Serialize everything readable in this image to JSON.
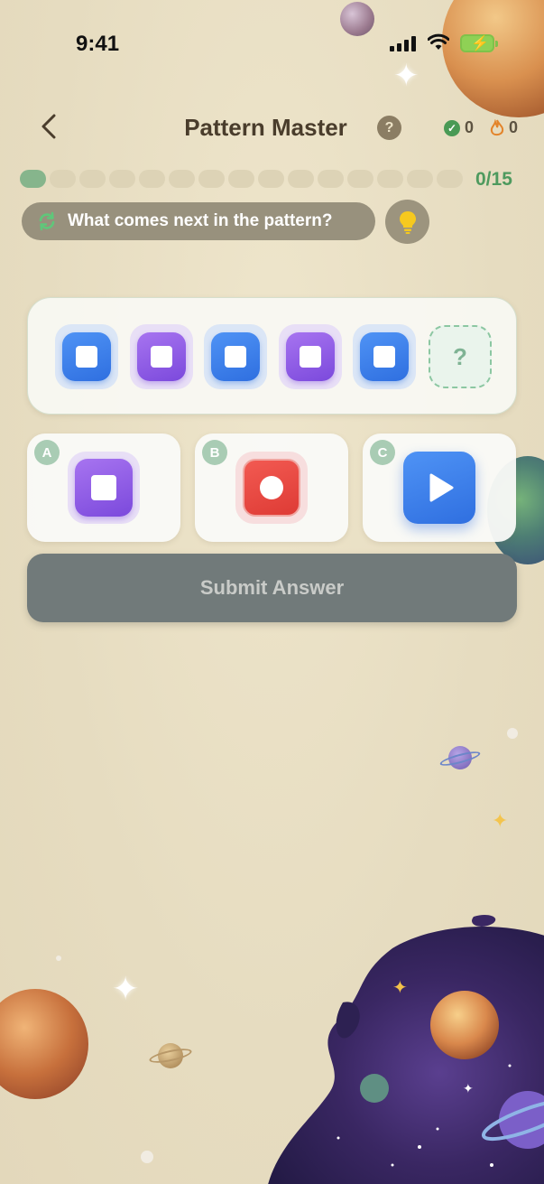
{
  "status_bar": {
    "time": "9:41"
  },
  "header": {
    "title": "Pattern Master",
    "help_label": "?",
    "correct_count": "0",
    "streak_count": "0"
  },
  "progress": {
    "current": 0,
    "total": 15,
    "text": "0/15"
  },
  "question": {
    "text": "What comes next in the pattern?"
  },
  "pattern": {
    "sequence": [
      "blue-square",
      "purple-square",
      "blue-square",
      "purple-square",
      "blue-square"
    ],
    "unknown_label": "?"
  },
  "options": [
    {
      "letter": "A",
      "icon": "purple-square"
    },
    {
      "letter": "B",
      "icon": "red-circle"
    },
    {
      "letter": "C",
      "icon": "blue-play"
    }
  ],
  "submit_label": "Submit Answer",
  "colors": {
    "background": "#e9dfc4",
    "accent_green": "#4e9a5e",
    "blue": "#2f6fe0",
    "purple": "#7b49dc",
    "red": "#de3b35",
    "submit_bg": "#717a7a"
  }
}
